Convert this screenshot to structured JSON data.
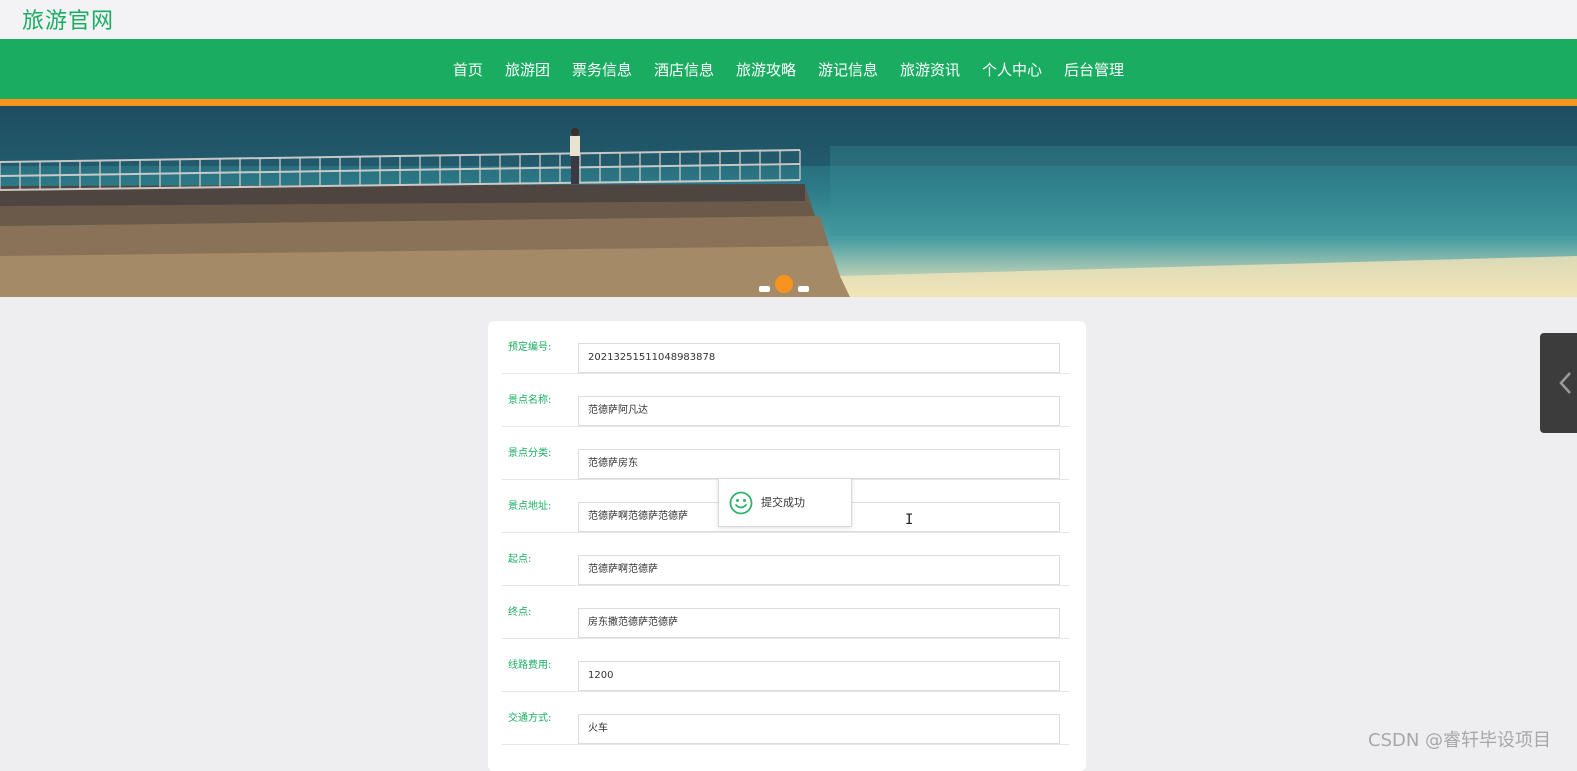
{
  "site": {
    "logo": "旅游官网"
  },
  "nav": {
    "items": [
      "首页",
      "旅游团",
      "票务信息",
      "酒店信息",
      "旅游攻略",
      "游记信息",
      "旅游资讯",
      "个人中心",
      "后台管理"
    ]
  },
  "banner": {
    "active_slide": 2,
    "total_slides": 3
  },
  "form": {
    "fields": [
      {
        "label": "预定编号:",
        "value": "20213251511048983878"
      },
      {
        "label": "景点名称:",
        "value": "范德萨阿凡达"
      },
      {
        "label": "景点分类:",
        "value": "范德萨房东"
      },
      {
        "label": "景点地址:",
        "value": "范德萨啊范德萨范德萨"
      },
      {
        "label": "起点:",
        "value": "范德萨啊范德萨"
      },
      {
        "label": "终点:",
        "value": "房东撒范德萨范德萨"
      },
      {
        "label": "线路费用:",
        "value": "1200"
      },
      {
        "label": "交通方式:",
        "value": "火车"
      }
    ]
  },
  "toast": {
    "message": "提交成功",
    "icon": "smiley-icon"
  },
  "watermark": "CSDN @睿轩毕设项目",
  "colors": {
    "brand_green": "#1aad62",
    "accent_orange": "#f7941d"
  }
}
